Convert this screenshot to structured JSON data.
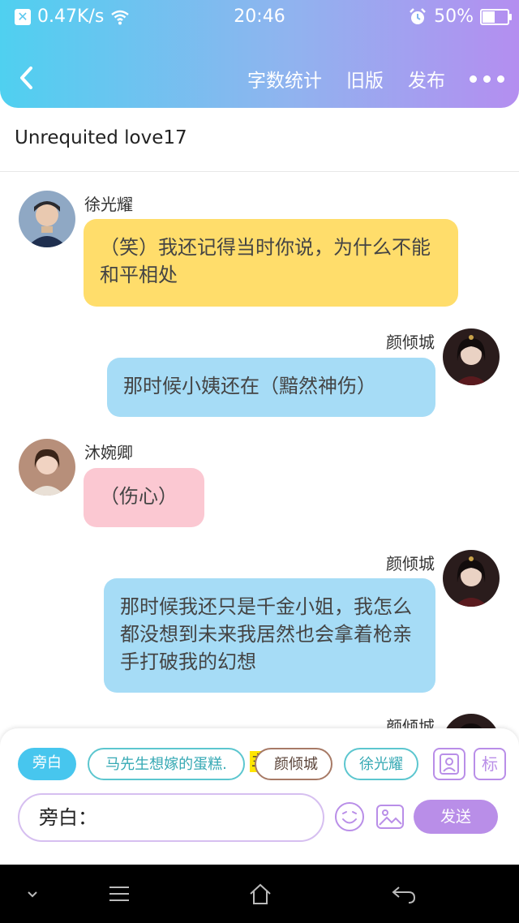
{
  "status_bar": {
    "speed": "0.47K/s",
    "time": "20:46",
    "battery": "50%",
    "battery_level": 0.5
  },
  "header": {
    "actions": [
      "字数统计",
      "旧版",
      "发布"
    ]
  },
  "story": {
    "title": "Unrequited love17"
  },
  "messages": [
    {
      "name": "徐光耀",
      "side": "left",
      "color": "yellow",
      "text": "（笑）我还记得当时你说，为什么不能和平相处"
    },
    {
      "name": "颜倾城",
      "side": "right",
      "color": "blue",
      "text": "那时候小姨还在（黯然神伤）"
    },
    {
      "name": "沐婉卿",
      "side": "left",
      "color": "pink",
      "text": "（伤心）"
    },
    {
      "name": "颜倾城",
      "side": "right",
      "color": "blue",
      "text": "那时候我还只是千金小姐，我怎么都没想到未来我居然也会拿着枪亲手打破我的幻想"
    },
    {
      "name": "颜倾城",
      "side": "right",
      "color": "blue",
      "text": ""
    }
  ],
  "composer": {
    "chips": [
      "旁白",
      "马先生想嫁的蛋糕.",
      "颜倾城",
      "徐光耀"
    ],
    "main_tag": "主",
    "mark_button": "标",
    "input_value": "旁白：",
    "send_label": "发送"
  },
  "colors": {
    "accent_purple": "#b98ee8",
    "accent_blue": "#47c6ee",
    "bubble_yellow": "#ffdd6b",
    "bubble_blue": "#a6dcf6",
    "bubble_pink": "#fbc8d2"
  }
}
